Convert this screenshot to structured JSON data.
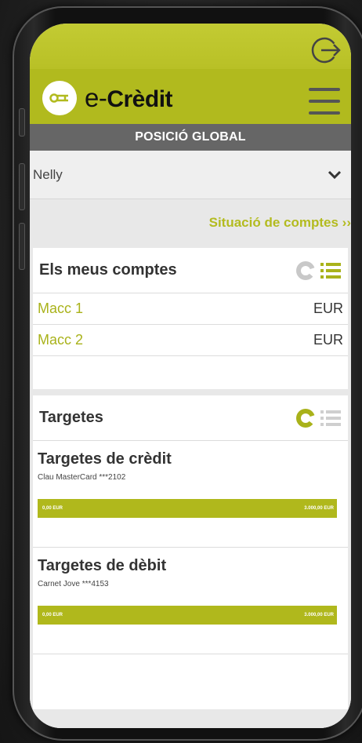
{
  "app": {
    "logo_prefix": "e-",
    "logo_name": "Crèdit"
  },
  "title_bar": "POSICIÓ GLOBAL",
  "user_select": {
    "value": "Nelly"
  },
  "situacio_link": "Situació de comptes ››",
  "accounts": {
    "title": "Els meus comptes",
    "rows": [
      {
        "name": "Macc 1",
        "currency": "EUR"
      },
      {
        "name": "Macc 2",
        "currency": "EUR"
      }
    ]
  },
  "cards": {
    "title": "Targetes",
    "credit": {
      "title": "Targetes de crèdit",
      "card_name": "Clau MasterCard ***2102",
      "bar_left": "0,00 EUR",
      "bar_right": "3.000,00 EUR"
    },
    "debit": {
      "title": "Targetes de dèbit",
      "card_name": "Carnet Jove ***4153",
      "bar_left": "0,00 EUR",
      "bar_right": "3.000,00 EUR"
    }
  },
  "icons": {
    "logout": "logout-icon",
    "menu": "hamburger-menu-icon",
    "dropdown": "chevron-down-icon",
    "chart": "pie-chart-icon",
    "list": "list-icon",
    "key": "key-icon"
  },
  "colors": {
    "brand": "#b1ba1e",
    "title_bar": "#666666",
    "accent_text": "#a9b21a"
  }
}
